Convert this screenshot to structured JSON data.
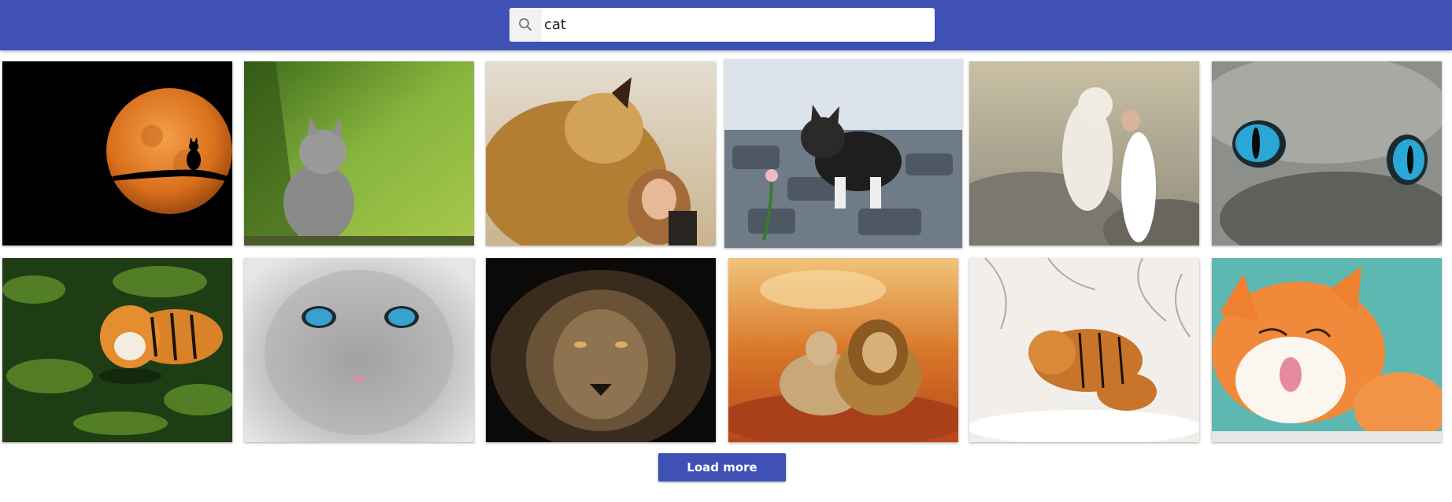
{
  "search": {
    "value": "cat",
    "icon": "search-icon"
  },
  "results": [
    {
      "name": "moon-cat-silhouette",
      "colors": [
        "#000000",
        "#e07a1f"
      ]
    },
    {
      "name": "gray-kitten-grass",
      "colors": [
        "#7aa33a",
        "#9a9a9a"
      ]
    },
    {
      "name": "lion-hugging-girl",
      "colors": [
        "#b88a3c",
        "#d9c39a"
      ]
    },
    {
      "name": "kitten-with-flower",
      "colors": [
        "#6f7f8c",
        "#2a2a2a"
      ]
    },
    {
      "name": "white-tiger-woman",
      "colors": [
        "#a8a090",
        "#f0f0ee"
      ]
    },
    {
      "name": "cat-blue-eyes-closeup",
      "colors": [
        "#8d8f8a",
        "#2aa7d6"
      ]
    },
    {
      "name": "tiger-in-water",
      "colors": [
        "#1f3d14",
        "#e08a2a"
      ]
    },
    {
      "name": "gray-cat-blue-eyes",
      "colors": [
        "#b5b5b5",
        "#39a1cf"
      ]
    },
    {
      "name": "lion-dark-portrait",
      "colors": [
        "#0c0a08",
        "#8a6a40"
      ]
    },
    {
      "name": "lions-sunset",
      "colors": [
        "#e08a3c",
        "#c8a070"
      ]
    },
    {
      "name": "tigers-in-snow",
      "colors": [
        "#eae6e2",
        "#c8742a"
      ]
    },
    {
      "name": "ginger-cat-licking",
      "colors": [
        "#5cb8b0",
        "#f08a3a"
      ]
    }
  ],
  "load_more": {
    "label": "Load more"
  }
}
